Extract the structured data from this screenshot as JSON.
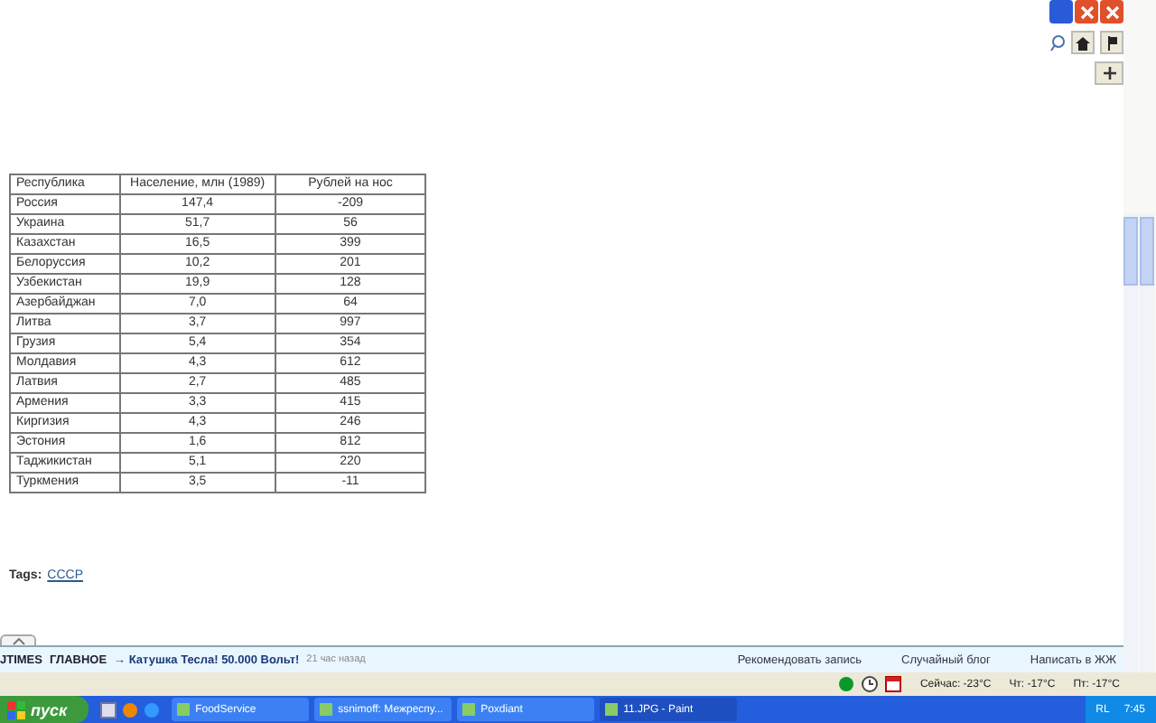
{
  "table": {
    "columns": [
      "Республика",
      "Население, млн (1989)",
      "Рублей на нос"
    ],
    "rows": [
      [
        "Россия",
        "147,4",
        "-209"
      ],
      [
        "Украина",
        "51,7",
        "56"
      ],
      [
        "Казахстан",
        "16,5",
        "399"
      ],
      [
        "Белоруссия",
        "10,2",
        "201"
      ],
      [
        "Узбекистан",
        "19,9",
        "128"
      ],
      [
        "Азербайджан",
        "7,0",
        "64"
      ],
      [
        "Литва",
        "3,7",
        "997"
      ],
      [
        "Грузия",
        "5,4",
        "354"
      ],
      [
        "Молдавия",
        "4,3",
        "612"
      ],
      [
        "Латвия",
        "2,7",
        "485"
      ],
      [
        "Армения",
        "3,3",
        "415"
      ],
      [
        "Киргизия",
        "4,3",
        "246"
      ],
      [
        "Эстония",
        "1,6",
        "812"
      ],
      [
        "Таджикистан",
        "5,1",
        "220"
      ],
      [
        "Туркмения",
        "3,5",
        "-11"
      ]
    ]
  },
  "tags": {
    "label": "Tags:",
    "links": [
      "СССР"
    ]
  },
  "news_bar": {
    "brand": "JTIMES",
    "section": "ГЛАВНОЕ",
    "arrow": "→",
    "headline": "Катушка Тесла! 50.000 Вольт!",
    "time": "21 час назад",
    "links": [
      "Рекомендовать запись",
      "Случайный блог",
      "Написать в ЖЖ"
    ]
  },
  "status_bar": {
    "weather": [
      "Сейчас: -23°C",
      "Чт: -17°C",
      "Пт: -17°C"
    ]
  },
  "taskbar": {
    "start": "пуск",
    "tasks": [
      {
        "label": "FoodService",
        "selected": false
      },
      {
        "label": "ssnimoff: Межреспу...",
        "selected": false
      },
      {
        "label": "Poxdiant",
        "selected": false
      },
      {
        "label": "11.JPG - Paint",
        "selected": true
      }
    ],
    "lang": "RL",
    "clock": "7:45"
  }
}
